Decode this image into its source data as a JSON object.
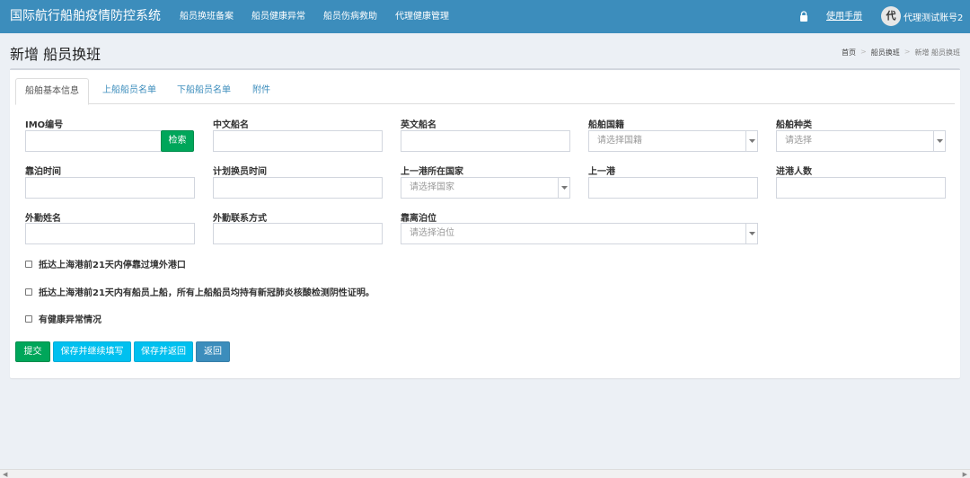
{
  "app": {
    "title": "国际航行船舶疫情防控系统",
    "nav": [
      "船员换班备案",
      "船员健康异常",
      "船员伤病救助",
      "代理健康管理"
    ],
    "manual": "使用手册",
    "user_avatar": "代",
    "user_name": "代理测试账号2"
  },
  "page": {
    "title": "新增 船员换班",
    "breadcrumb": [
      "首页",
      "船员换班",
      "新增 船员换班"
    ]
  },
  "tabs": [
    "船舶基本信息",
    "上船船员名单",
    "下船船员名单",
    "附件"
  ],
  "form": {
    "imo_label": "IMO编号",
    "search_button": "检索",
    "cn_name_label": "中文船名",
    "en_name_label": "英文船名",
    "nationality_label": "船舶国籍",
    "nationality_placeholder": "请选择国籍",
    "ship_type_label": "船舶种类",
    "ship_type_placeholder": "请选择",
    "berth_time_label": "靠泊时间",
    "plan_time_label": "计划换员时间",
    "last_country_label": "上一港所在国家",
    "last_country_placeholder": "请选择国家",
    "last_port_label": "上一港",
    "entry_count_label": "进港人数",
    "agent_name_label": "外勤姓名",
    "agent_contact_label": "外勤联系方式",
    "berth_label": "靠离泊位",
    "berth_placeholder": "请选择泊位",
    "checks": [
      "抵达上海港前21天内停靠过境外港口",
      "抵达上海港前21天内有船员上船，所有上船船员均持有新冠肺炎核酸检测阴性证明。",
      "有健康异常情况"
    ]
  },
  "buttons": {
    "submit": "提交",
    "save_continue": "保存并继续填写",
    "save_return": "保存并返回",
    "back": "返回"
  },
  "colors": {
    "header": "#3c8dbc",
    "success": "#00a65a",
    "info": "#00c0ef",
    "primary": "#3c8dbc",
    "background": "#ecf0f5"
  }
}
